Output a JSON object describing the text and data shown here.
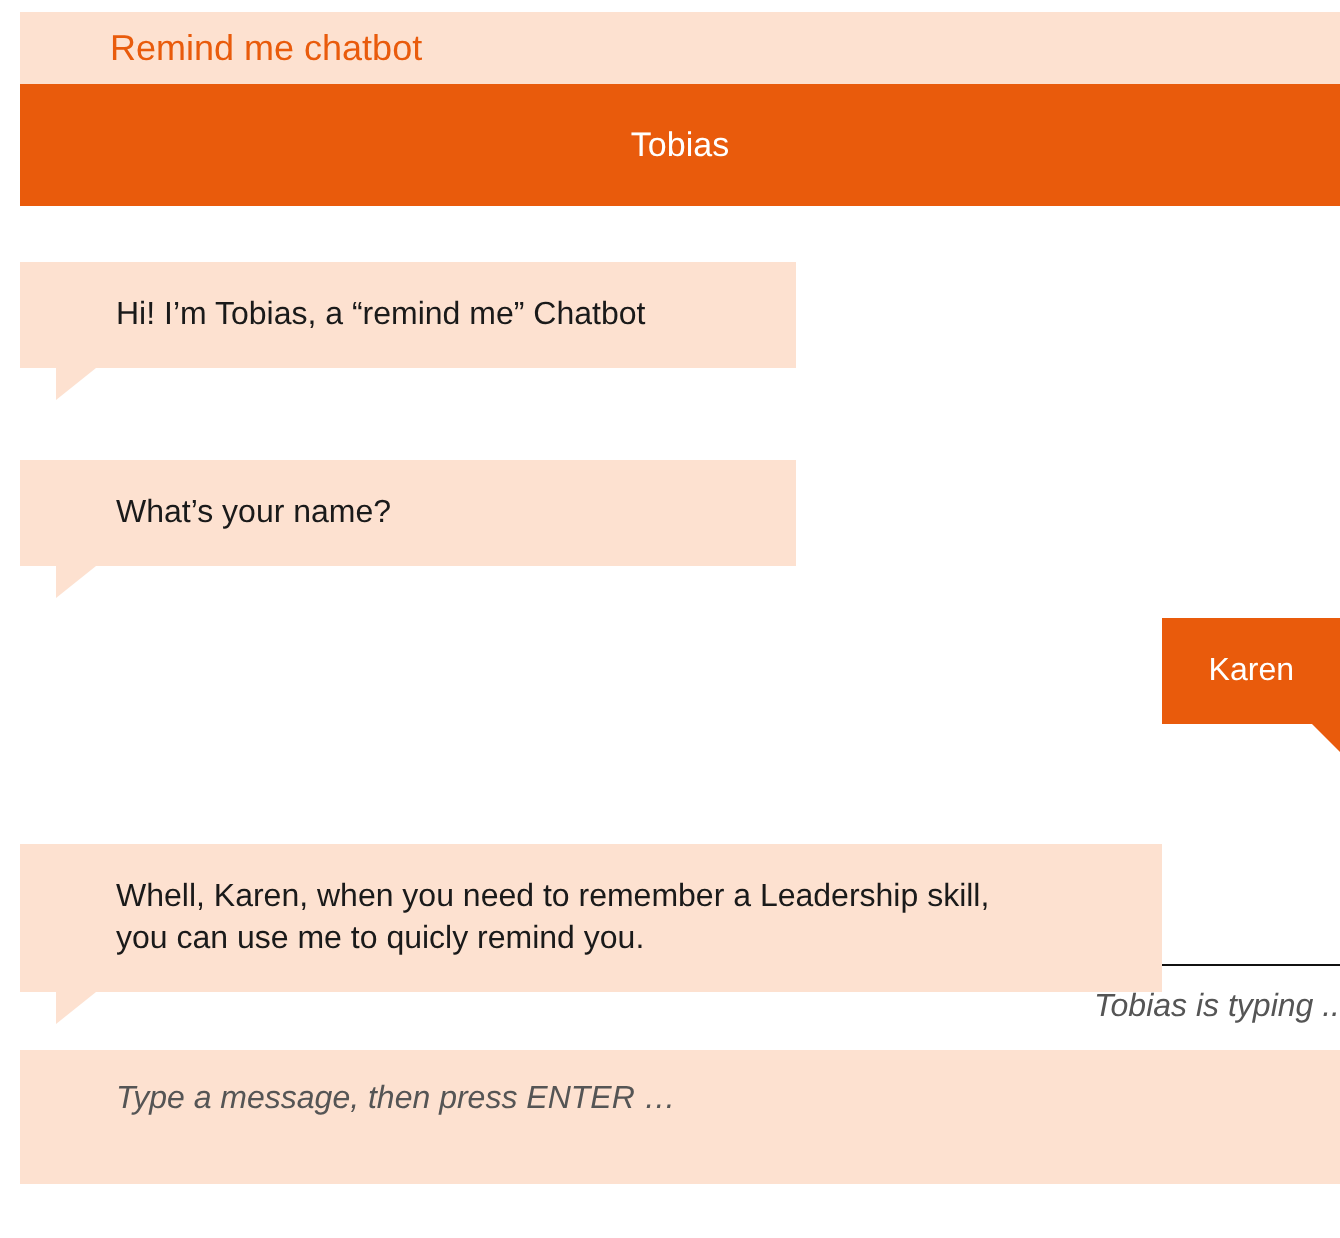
{
  "app_title": "Remind me chatbot",
  "chat_header": {
    "title": "Tobias"
  },
  "messages": [
    {
      "kind": "bot",
      "text": "Hi! I’m Tobias, a “remind me” Chatbot"
    },
    {
      "kind": "bot",
      "text": "What’s your name?"
    },
    {
      "kind": "user",
      "text": "Karen"
    },
    {
      "kind": "bot",
      "text": "Whell, Karen, when you need to remember a Leadership skill, you can use me to quicly remind you."
    }
  ],
  "typing_status": "Tobias is typing ..",
  "composer": {
    "placeholder": "Type a message, then press ENTER …"
  }
}
